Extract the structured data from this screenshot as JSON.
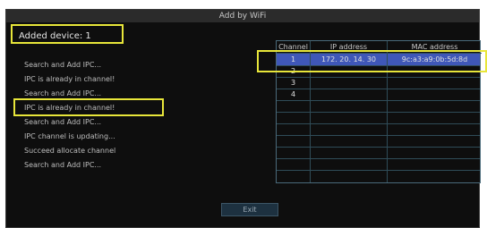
{
  "dialog": {
    "title": "Add by WiFi",
    "added_device": "Added device: 1"
  },
  "log": [
    "Search and Add IPC...",
    "IPC is already in channel!",
    "Search and Add IPC...",
    "IPC is already in channel!",
    "Search and Add IPC...",
    "IPC channel is updating...",
    "Succeed allocate channel",
    "Search and Add IPC..."
  ],
  "table": {
    "headers": [
      "Channel",
      "IP address",
      "MAC address"
    ],
    "rows": [
      [
        "1",
        "172. 20. 14. 30",
        "9c:a3:a9:0b:5d:8d"
      ],
      [
        "2",
        "",
        ""
      ],
      [
        "3",
        "",
        ""
      ],
      [
        "4",
        "",
        ""
      ],
      [
        "",
        "",
        ""
      ],
      [
        "",
        "",
        ""
      ],
      [
        "",
        "",
        ""
      ],
      [
        "",
        "",
        ""
      ],
      [
        "",
        "",
        ""
      ],
      [
        "",
        "",
        ""
      ],
      [
        "",
        "",
        ""
      ]
    ]
  },
  "buttons": {
    "exit": "Exit"
  },
  "colors": {
    "highlight_box": "#e8e63a",
    "selected_row": "#3f57b8",
    "background": "#0e0e0e"
  }
}
